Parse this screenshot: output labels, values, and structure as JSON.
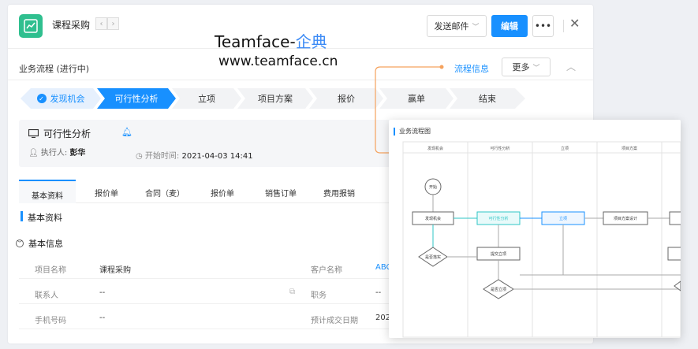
{
  "header": {
    "title": "课程采购",
    "prev_icon": "chevron-left-icon",
    "next_icon": "chevron-right-icon",
    "send_mail_label": "发送邮件",
    "edit_label": "编辑",
    "more_label": "•••",
    "close_label": "✕"
  },
  "watermark": {
    "brand": "Teamface-",
    "brand_cn": "企典",
    "url": "www.teamface.cn"
  },
  "process": {
    "title": "业务流程 (进行中)",
    "info_link": "流程信息",
    "more_label": "更多",
    "stages": [
      {
        "label": "发现机会",
        "state": "done"
      },
      {
        "label": "可行性分析",
        "state": "current"
      },
      {
        "label": "立项",
        "state": "todo"
      },
      {
        "label": "项目方案",
        "state": "todo"
      },
      {
        "label": "报价",
        "state": "todo"
      },
      {
        "label": "赢单",
        "state": "todo"
      },
      {
        "label": "结束",
        "state": "todo"
      }
    ]
  },
  "stage_panel": {
    "title": "可行性分析",
    "executor_label": "执行人:",
    "executor": "彭华",
    "start_label": "开始时间:",
    "start_time": "2021-04-03 14:41"
  },
  "tabs": [
    "基本资料",
    "报价单",
    "合同（麦）",
    "报价单",
    "销售订单",
    "费用报销"
  ],
  "section": {
    "title": "基本资料",
    "subsection": "基本信息"
  },
  "fields": [
    {
      "label": "项目名称",
      "value": "课程采购",
      "label2": "客户名称",
      "value2": "ABC"
    },
    {
      "label": "联系人",
      "value": "--",
      "label2": "职务",
      "value2": "--"
    },
    {
      "label": "手机号码",
      "value": "--",
      "label2": "预计成交日期",
      "value2": "202"
    }
  ],
  "flow": {
    "title": "业务流程图",
    "lanes": [
      "发现机会",
      "可行性分析",
      "立项",
      "项目方案"
    ],
    "nodes": {
      "start": "开始",
      "discover": "发现机会",
      "feasibility": "可行性分析",
      "approve": "立项",
      "design": "项目方案设计",
      "review": "是否落实",
      "submit": "提交立项",
      "confirm": "是否立项"
    }
  },
  "colors": {
    "accent": "#1890ff",
    "connector": "#f5a25d",
    "app_icon": "#2fbf8f"
  }
}
